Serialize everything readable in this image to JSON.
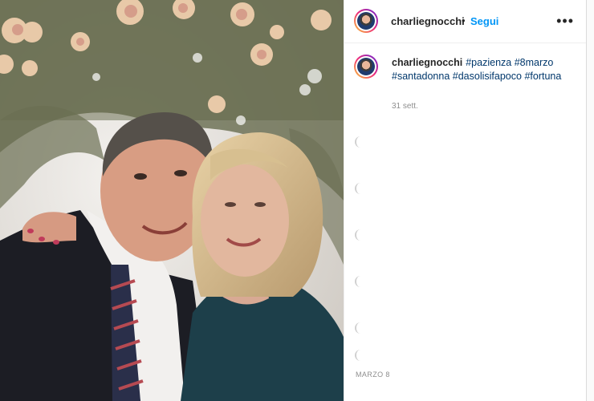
{
  "post": {
    "username": "charliegnocchi",
    "dot": "•",
    "follow_label": "Segui",
    "more_label": "•••",
    "caption_username": "charliegnocchi",
    "hashtags": [
      "#pazienza",
      "#8marzo",
      "#santadonna",
      "#dasolisifapoco",
      "#fortuna"
    ],
    "comment_age": "31 sett.",
    "post_date": "MARZO 8"
  },
  "icons": {
    "avatar": "profile-avatar",
    "more": "more-options-icon"
  },
  "colors": {
    "link": "#0095f6",
    "hashtag": "#00376b",
    "meta": "#8e8e8e",
    "text": "#262626"
  }
}
